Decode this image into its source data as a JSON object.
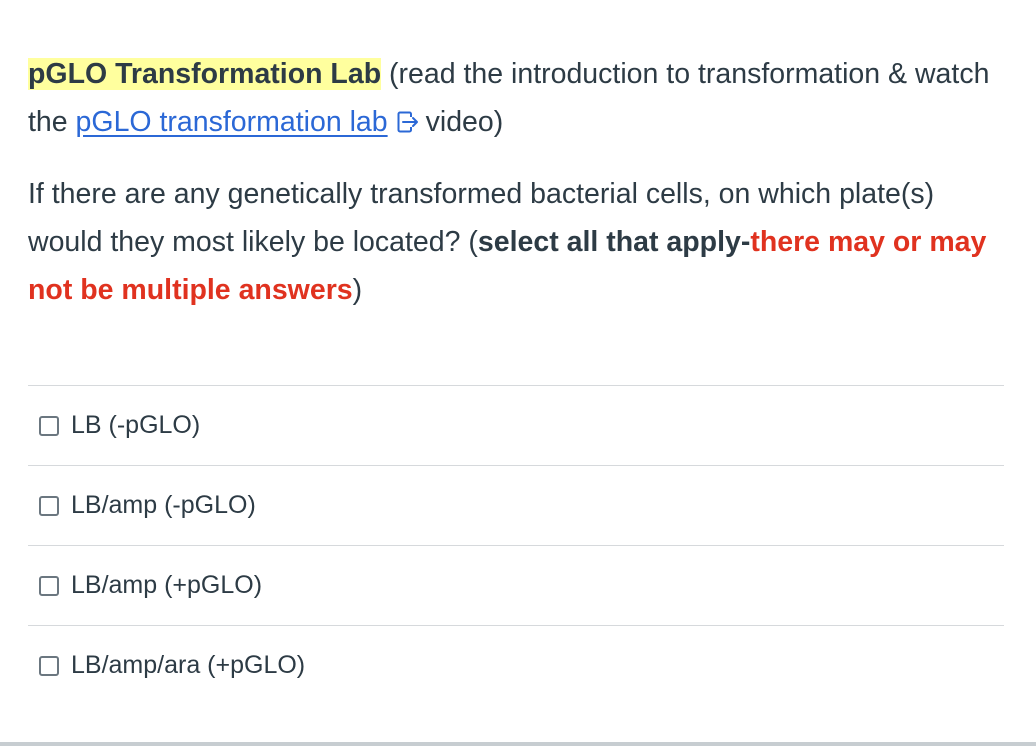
{
  "question": {
    "title_highlight": "pGLO Transformation Lab",
    "intro_text_1": " (read the introduction to transformation & watch the ",
    "link_text": "pGLO transformation lab",
    "intro_text_2": "video)",
    "prompt_text": "If there are any genetically transformed bacterial cells, on which plate(s) would they most likely be located? (",
    "prompt_bold": "select all that apply-",
    "prompt_red": "there may or may not be multiple answers",
    "prompt_end": ")",
    "colors": {
      "highlight": "#ffff9e",
      "link": "#2b68d6",
      "emphasis_red": "#e0321f",
      "text": "#2d3b45"
    }
  },
  "answers": [
    {
      "label": "LB (-pGLO)",
      "checked": false
    },
    {
      "label": "LB/amp (-pGLO)",
      "checked": false
    },
    {
      "label": "LB/amp (+pGLO)",
      "checked": false
    },
    {
      "label": "LB/amp/ara (+pGLO)",
      "checked": false
    }
  ],
  "icons": {
    "external_link": "external-link-icon",
    "checkbox": "checkbox-icon"
  }
}
